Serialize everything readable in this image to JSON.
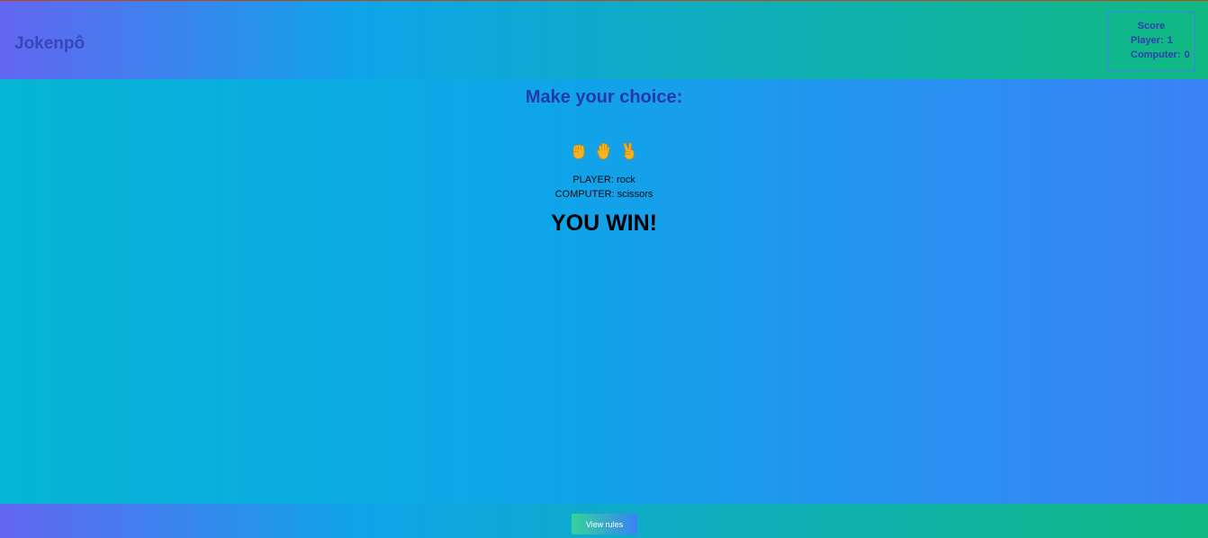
{
  "header": {
    "title": "Jokenpô",
    "score": {
      "title": "Score",
      "player_label": "Player:",
      "player_value": "1",
      "computer_label": "Computer:",
      "computer_value": "0"
    }
  },
  "main": {
    "prompt": "Make your choice:",
    "choices": [
      {
        "name": "rock",
        "icon": "raised-fist-icon",
        "color": "#f6b321"
      },
      {
        "name": "paper",
        "icon": "raised-hand-icon",
        "color": "#f6b321"
      },
      {
        "name": "scissors",
        "icon": "victory-hand-icon",
        "color": "#f6b321"
      }
    ],
    "player_result": "PLAYER: rock",
    "computer_result": "COMPUTER: scissors",
    "verdict": "YOU WIN!"
  },
  "footer": {
    "rules_label": "View rules"
  },
  "colors": {
    "header_gradient": [
      "#6366f1",
      "#0ea5e9",
      "#10b981"
    ],
    "body_gradient": [
      "#06b6d4",
      "#0ea5e9",
      "#3b82f6"
    ],
    "title_text": "#3746b8",
    "emoji_yellow": "#f6b321"
  }
}
